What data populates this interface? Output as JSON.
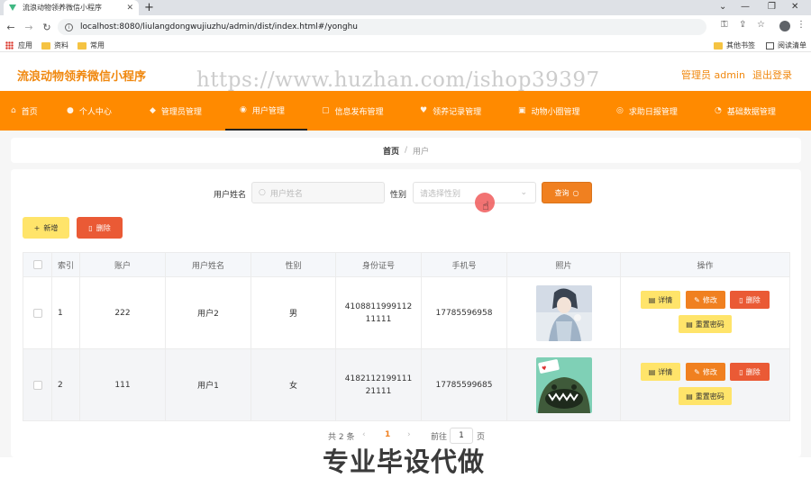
{
  "browser": {
    "tab_title": "流浪动物领养微信小程序",
    "tab_close": "✕",
    "new_tab": "+",
    "url": "localhost:8080/liulangdongwujiuzhu/admin/dist/index.html#/yonghu",
    "bookmarks": [
      "应用",
      "资料",
      "常用"
    ],
    "other_bookmarks": "其他书签",
    "reading_list": "阅读清单"
  },
  "header": {
    "title": "流浪动物领养微信小程序",
    "user": "管理员 admin",
    "logout": "退出登录"
  },
  "watermarks": {
    "url": "https://www.huzhan.com/ishop39397",
    "banner": "专业毕设代做"
  },
  "nav": {
    "items": [
      {
        "label": "首页",
        "icon": "home-icon"
      },
      {
        "label": "个人中心",
        "icon": "user-icon"
      },
      {
        "label": "管理员管理",
        "icon": "admin-icon"
      },
      {
        "label": "用户管理",
        "icon": "users-icon"
      },
      {
        "label": "信息发布管理",
        "icon": "doc-icon"
      },
      {
        "label": "领养记录管理",
        "icon": "heart-icon"
      },
      {
        "label": "动物小圈管理",
        "icon": "circle-icon"
      },
      {
        "label": "求助日报管理",
        "icon": "help-icon"
      },
      {
        "label": "基础数据管理",
        "icon": "settings-icon"
      }
    ],
    "active_index": 3
  },
  "breadcrumb": {
    "home": "首页",
    "separator": "/",
    "current": "用户"
  },
  "search": {
    "name_label": "用户姓名",
    "name_placeholder": "用户姓名",
    "gender_label": "性别",
    "gender_placeholder": "请选择性别",
    "query_button": "查询"
  },
  "actions": {
    "add": "新增",
    "delete": "删除"
  },
  "table": {
    "columns": [
      "",
      "索引",
      "账户",
      "用户姓名",
      "性别",
      "身份证号",
      "手机号",
      "照片",
      "操作"
    ],
    "rows": [
      {
        "index": "1",
        "account": "222",
        "name": "用户2",
        "gender": "男",
        "id_card": "410881199911211111",
        "phone": "17785596958",
        "photo": "girl-illustration"
      },
      {
        "index": "2",
        "account": "111",
        "name": "用户1",
        "gender": "女",
        "id_card": "418211219911121111",
        "phone": "17785599685",
        "photo": "green-monster-xmas"
      }
    ],
    "ops": {
      "detail": "详情",
      "edit": "修改",
      "delete": "删除",
      "reset_password": "重置密码"
    }
  },
  "pagination": {
    "total": "共 2 条",
    "current_page": "1",
    "goto_prefix": "前往",
    "goto_value": "1",
    "goto_suffix": "页"
  },
  "colors": {
    "accent": "#ff8a00",
    "yellow": "#ffe46a",
    "red": "#ea5a35",
    "orange_button": "#f08020"
  }
}
